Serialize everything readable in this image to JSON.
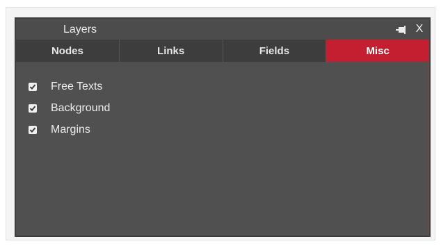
{
  "panel": {
    "title": "Layers",
    "close_label": "X"
  },
  "tabs": [
    {
      "label": "Nodes",
      "active": false
    },
    {
      "label": "Links",
      "active": false
    },
    {
      "label": "Fields",
      "active": false
    },
    {
      "label": "Misc",
      "active": true
    }
  ],
  "items": [
    {
      "label": "Free Texts",
      "checked": true
    },
    {
      "label": "Background",
      "checked": true
    },
    {
      "label": "Margins",
      "checked": true
    }
  ],
  "colors": {
    "active_tab": "#c41f30",
    "panel_bg": "#505050",
    "tab_bg": "#3d3d3d"
  },
  "icons": {
    "pin": "pin-icon",
    "close": "close-icon",
    "check": "checkmark-icon"
  }
}
